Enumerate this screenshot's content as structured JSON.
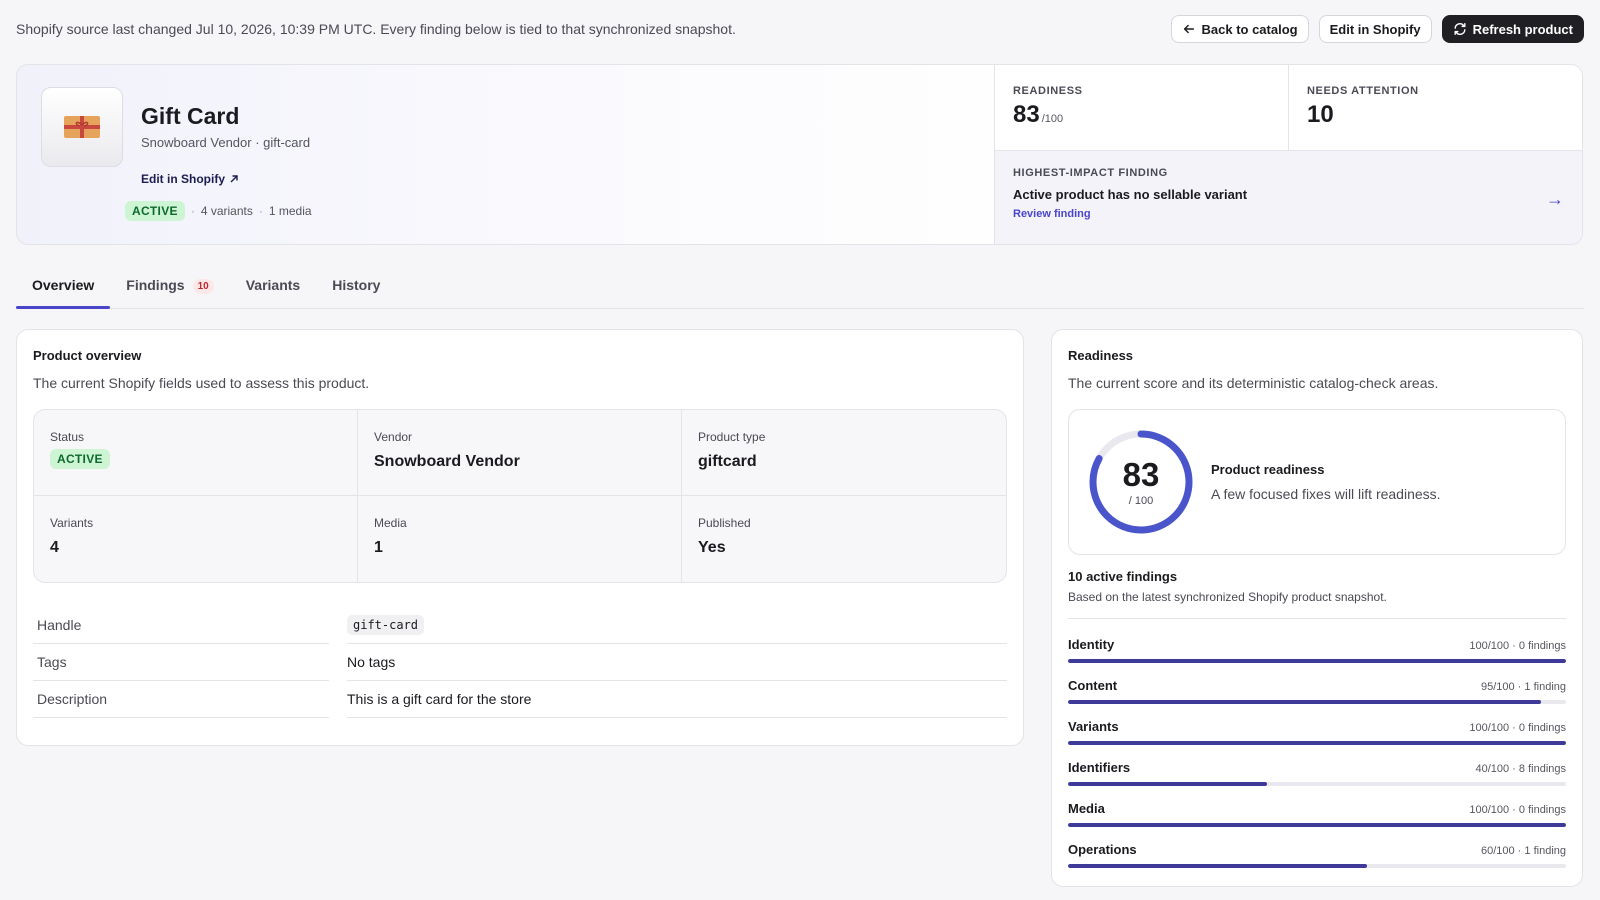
{
  "sync_note": "Shopify source last changed Jul 10, 2026, 10:39 PM UTC. Every finding below is tied to that synchronized snapshot.",
  "actions": {
    "back": "Back to catalog",
    "edit": "Edit in Shopify",
    "refresh": "Refresh product"
  },
  "product": {
    "title": "Gift Card",
    "subtitle": "Snowboard Vendor · gift-card",
    "edit_link": "Edit in Shopify",
    "status": "ACTIVE",
    "variants_meta": "4 variants",
    "media_meta": "1 media"
  },
  "stats": {
    "readiness_label": "READINESS",
    "readiness_value": "83",
    "readiness_suffix": "/100",
    "attention_label": "NEEDS ATTENTION",
    "attention_value": "10"
  },
  "impact": {
    "label": "HIGHEST-IMPACT FINDING",
    "title": "Active product has no sellable variant",
    "link": "Review finding"
  },
  "tabs": [
    {
      "label": "Overview"
    },
    {
      "label": "Findings",
      "count": "10"
    },
    {
      "label": "Variants"
    },
    {
      "label": "History"
    }
  ],
  "overview": {
    "title": "Product overview",
    "description": "The current Shopify fields used to assess this product.",
    "fields": {
      "status_label": "Status",
      "status_value": "ACTIVE",
      "vendor_label": "Vendor",
      "vendor_value": "Snowboard Vendor",
      "type_label": "Product type",
      "type_value": "giftcard",
      "variants_label": "Variants",
      "variants_value": "4",
      "media_label": "Media",
      "media_value": "1",
      "published_label": "Published",
      "published_value": "Yes"
    },
    "details": {
      "handle_label": "Handle",
      "handle_value": "gift-card",
      "tags_label": "Tags",
      "tags_value": "No tags",
      "description_label": "Description",
      "description_value": "This is a gift card for the store"
    }
  },
  "readiness": {
    "title": "Readiness",
    "description": "The current score and its deterministic catalog-check areas.",
    "score": 83,
    "score_display": "83",
    "score_max": "/ 100",
    "score_label": "Product readiness",
    "score_text": "A few focused fixes will lift readiness.",
    "active_findings": "10 active findings",
    "findings_note": "Based on the latest synchronized Shopify product snapshot.",
    "areas": [
      {
        "name": "Identity",
        "meta": "100/100 · 0 findings",
        "score": 100
      },
      {
        "name": "Content",
        "meta": "95/100 · 1 finding",
        "score": 95
      },
      {
        "name": "Variants",
        "meta": "100/100 · 0 findings",
        "score": 100
      },
      {
        "name": "Identifiers",
        "meta": "40/100 · 8 findings",
        "score": 40
      },
      {
        "name": "Media",
        "meta": "100/100 · 0 findings",
        "score": 100
      },
      {
        "name": "Operations",
        "meta": "60/100 · 1 finding",
        "score": 60
      }
    ]
  },
  "colors": {
    "accent": "#4a45c9",
    "bar": "#3d3a9a",
    "active_badge_bg": "#cdf5d4",
    "active_badge_text": "#0e6a2a"
  }
}
